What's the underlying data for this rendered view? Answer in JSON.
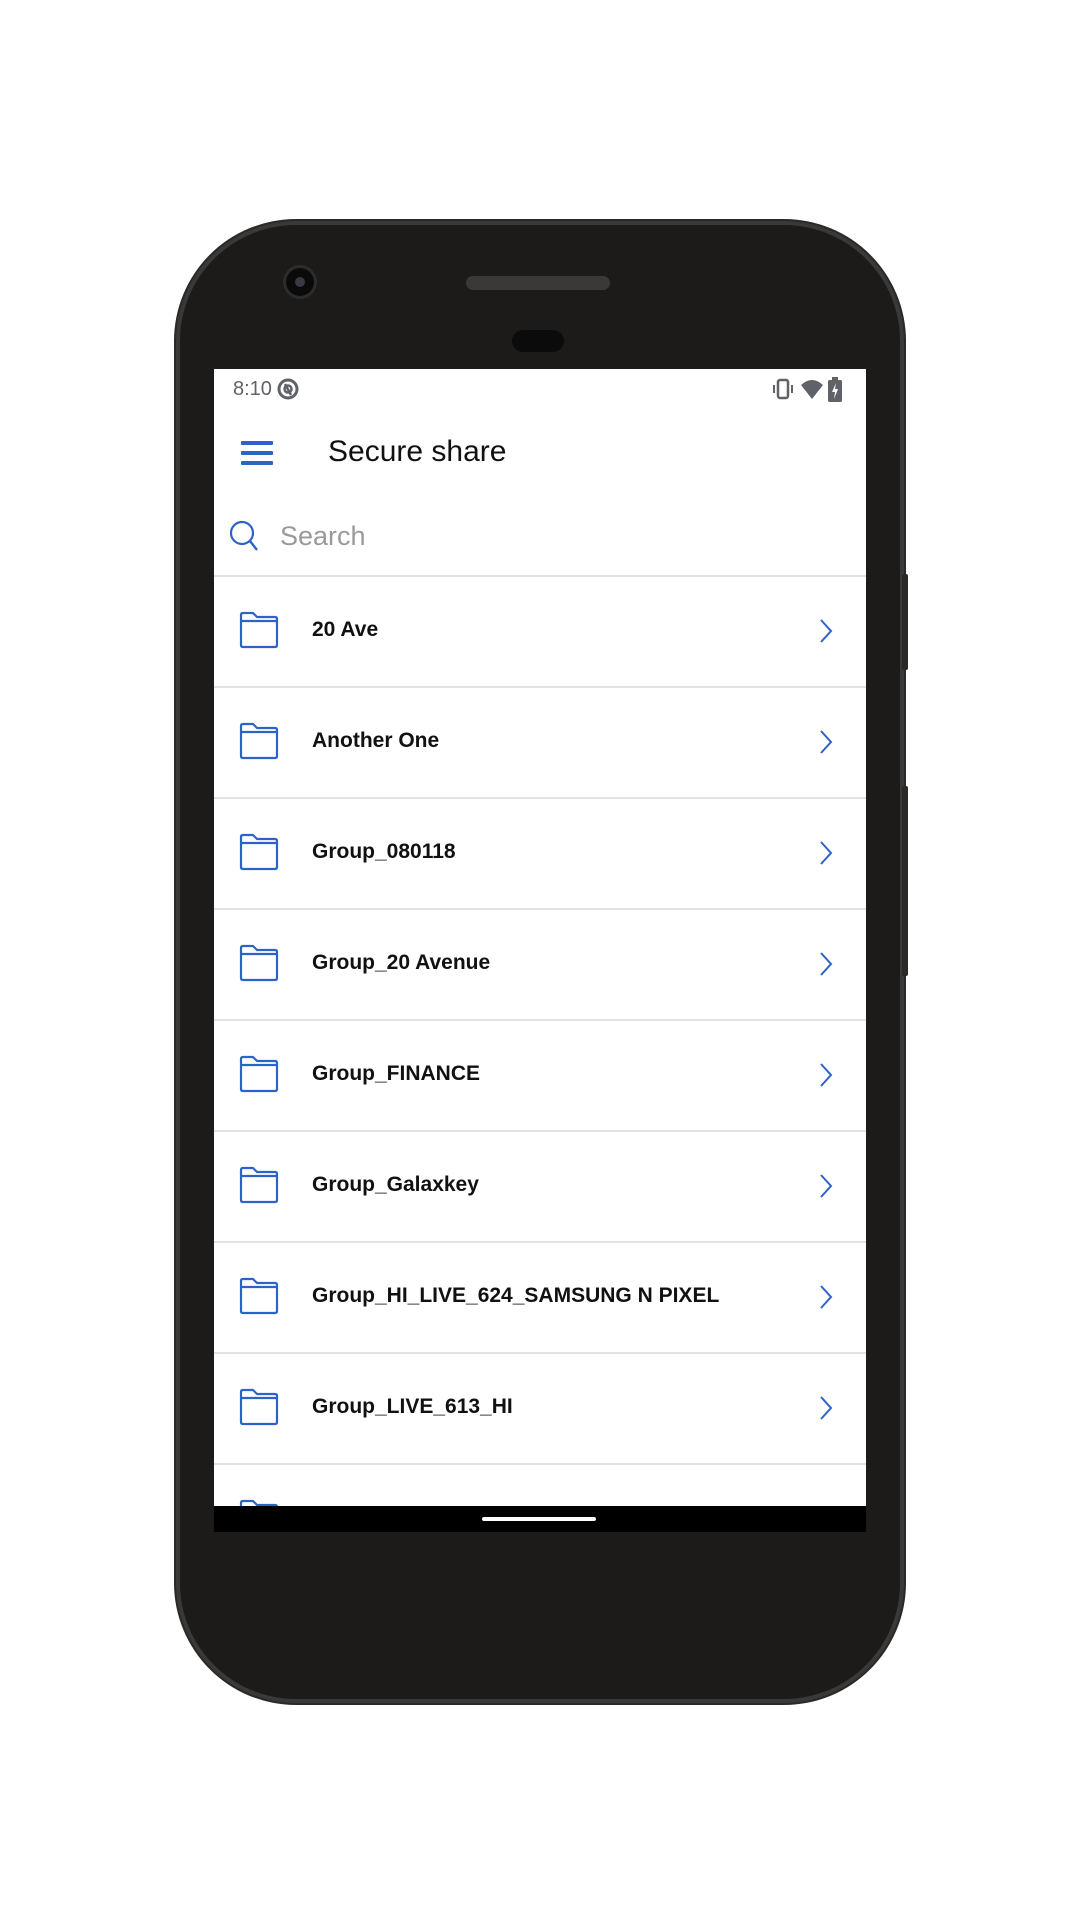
{
  "status_bar": {
    "time": "8:10",
    "icons": [
      "sync-icon",
      "vibrate-icon",
      "wifi-icon",
      "battery-charging-icon"
    ]
  },
  "app_bar": {
    "title": "Secure share",
    "menu_icon": "hamburger-menu-icon"
  },
  "search": {
    "placeholder": "Search",
    "value": ""
  },
  "colors": {
    "accent": "#2d63c8",
    "divider": "#e2e2e2",
    "text": "#111111"
  },
  "folders": [
    {
      "label": "20 Ave"
    },
    {
      "label": "Another One"
    },
    {
      "label": "Group_080118"
    },
    {
      "label": "Group_20 Avenue"
    },
    {
      "label": "Group_FINANCE"
    },
    {
      "label": "Group_Galaxkey"
    },
    {
      "label": "Group_HI_LIVE_624_SAMSUNG N PIXEL"
    },
    {
      "label": "Group_LIVE_613_HI"
    },
    {
      "label": ""
    }
  ]
}
